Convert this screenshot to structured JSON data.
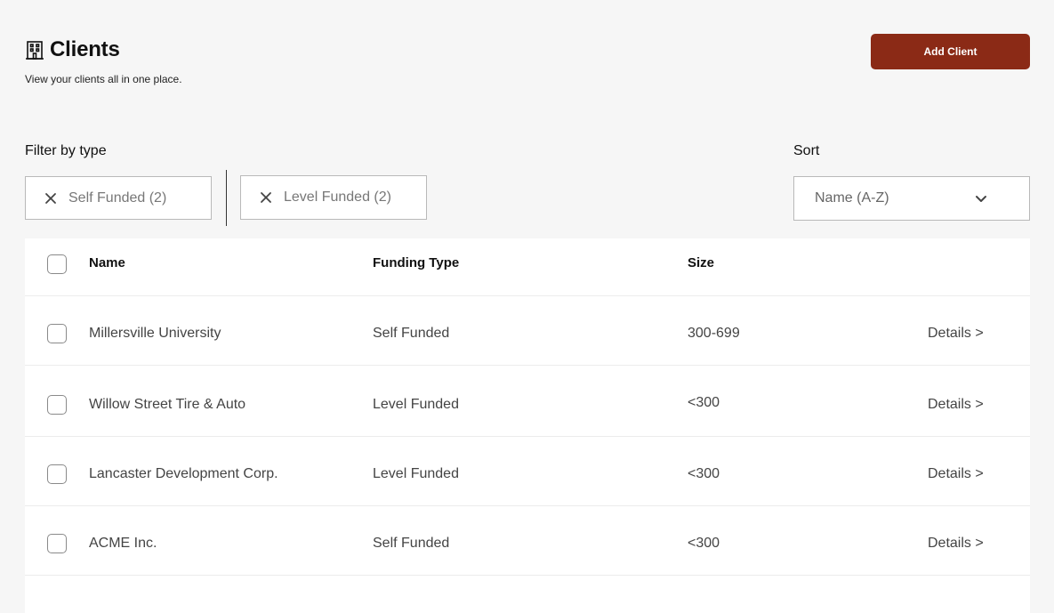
{
  "header": {
    "title": "Clients",
    "subtitle": "View your clients all in one place.",
    "add_button": "Add Client"
  },
  "filters": {
    "label": "Filter by type",
    "chips": [
      {
        "label": "Self Funded (2)"
      },
      {
        "label": "Level Funded (2)"
      }
    ]
  },
  "sort": {
    "label": "Sort",
    "selected": "Name (A-Z)"
  },
  "table": {
    "columns": [
      "Name",
      "Funding Type",
      "Size"
    ],
    "rows": [
      {
        "name": "Millersville University",
        "type": "Self Funded",
        "size": "300-699",
        "action": "Details >"
      },
      {
        "name": "Willow Street Tire & Auto",
        "type": "Level Funded",
        "size": "<300",
        "action": "Details >"
      },
      {
        "name": "Lancaster Development Corp.",
        "type": "Level Funded",
        "size": "<300",
        "action": "Details >"
      },
      {
        "name": "ACME Inc.",
        "type": "Self Funded",
        "size": "<300",
        "action": "Details >"
      }
    ]
  },
  "colors": {
    "accent": "#8b2a16",
    "background": "#f6f6f6"
  }
}
